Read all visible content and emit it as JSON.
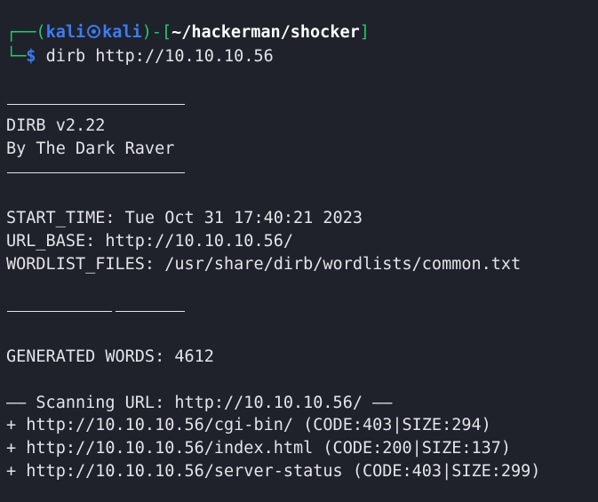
{
  "prompt": {
    "corner_top": "┌──",
    "open_paren": "(",
    "user": "kali",
    "host": "kali",
    "close_paren": ")",
    "dash_open": "-[",
    "path": "~/hackerman/shocker",
    "close_bracket": "]",
    "corner_bottom": "└─",
    "dollar": "$",
    "command": "dirb http://10.10.10.56"
  },
  "banner": {
    "title": "DIRB v2.22",
    "author": "By The Dark Raver"
  },
  "info": {
    "start_time": "START_TIME: Tue Oct 31 17:40:21 2023",
    "url_base": "URL_BASE: http://10.10.10.56/",
    "wordlist": "WORDLIST_FILES: /usr/share/dirb/wordlists/common.txt"
  },
  "generated": "GENERATED WORDS: 4612",
  "scanning": "—— Scanning URL: http://10.10.10.56/ ——",
  "results": [
    "+ http://10.10.10.56/cgi-bin/ (CODE:403|SIZE:294)",
    "+ http://10.10.10.56/index.html (CODE:200|SIZE:137)",
    "+ http://10.10.10.56/server-status (CODE:403|SIZE:299)"
  ]
}
